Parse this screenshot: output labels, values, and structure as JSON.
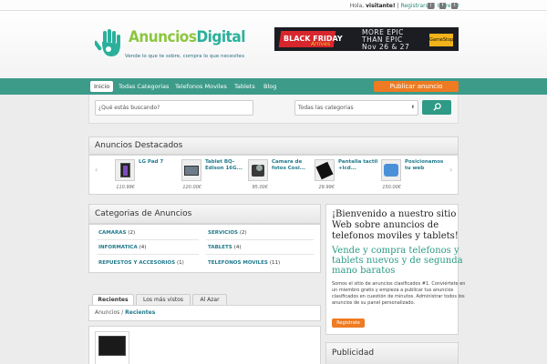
{
  "topbar": {
    "greeting": "Hola,",
    "user": "visitante!",
    "register": "Registrarse",
    "sep": "|",
    "login": "Ingresar",
    "sep2": "|"
  },
  "header": {
    "logo_part1": "Anuncios",
    "logo_part2": "Digital",
    "tagline": "Vende lo que te sobre, compra lo que necesites"
  },
  "banner": {
    "line1": "BLACK FRIDAY",
    "line2": "Arrives",
    "line3": "MORE EPIC",
    "line4": "THAN EPIC",
    "line5": "Nov 26 & 27",
    "brand": "GameStop"
  },
  "nav": {
    "items": [
      "Inicio",
      "Todas Categorias",
      "Telefonos Moviles",
      "Tablets",
      "Blog"
    ],
    "publish": "Publicar anuncio"
  },
  "search": {
    "placeholder": "¿Qué estás buscando?",
    "category": "Todas las categorias",
    "arrow": "⬍",
    "button_icon": "search-icon"
  },
  "featured": {
    "title": "Anuncios Destacados",
    "items": [
      {
        "title": "LG Pad 7",
        "price": "110.99€"
      },
      {
        "title": "Tablet BQ-Edison 16G...",
        "price": "120.00€"
      },
      {
        "title": "Camara de fotos Cosi...",
        "price": "95.00€"
      },
      {
        "title": "Pantalla tactil +lcd...",
        "price": "29.99€"
      },
      {
        "title": "Posicionamos tu web",
        "price": "150.00€"
      }
    ]
  },
  "categories": {
    "title": "Categorias de Anuncios",
    "items": [
      {
        "name": "CAMARAS",
        "count": "(2)"
      },
      {
        "name": "SERVICIOS",
        "count": "(2)"
      },
      {
        "name": "INFORMATICA",
        "count": "(4)"
      },
      {
        "name": "TABLETS",
        "count": "(4)"
      },
      {
        "name": "REPUESTOS Y ACCESORIOS",
        "count": "(1)"
      },
      {
        "name": "TELEFONOS MOVILES",
        "count": "(11)"
      }
    ]
  },
  "welcome": {
    "title": "¡Bienvenido a nuestro sitio Web sobre anuncios de telefonos moviles y tablets!",
    "subtitle": "Vende y compra telefonos y tablets nuevos y de segunda mano baratos",
    "body": "Somos el sitio de anuncios clasificados #1. Conviértete en un miembro gratis y empieza a publicar tus anuncios clasificados en cuestión de minutos. Administrar todos los anuncios de su panel personalizado.",
    "register": "Registrate"
  },
  "tabs": [
    "Recientes",
    "Los más vistos",
    "Al Azar"
  ],
  "breadcrumb": {
    "root": "Anuncios",
    "sep": "/",
    "current": "Recientes"
  },
  "ads": {
    "title": "Publicidad"
  },
  "colors": {
    "accent": "#3d9b8a",
    "orange": "#ee7b22",
    "logo_green": "#8cc63f"
  }
}
